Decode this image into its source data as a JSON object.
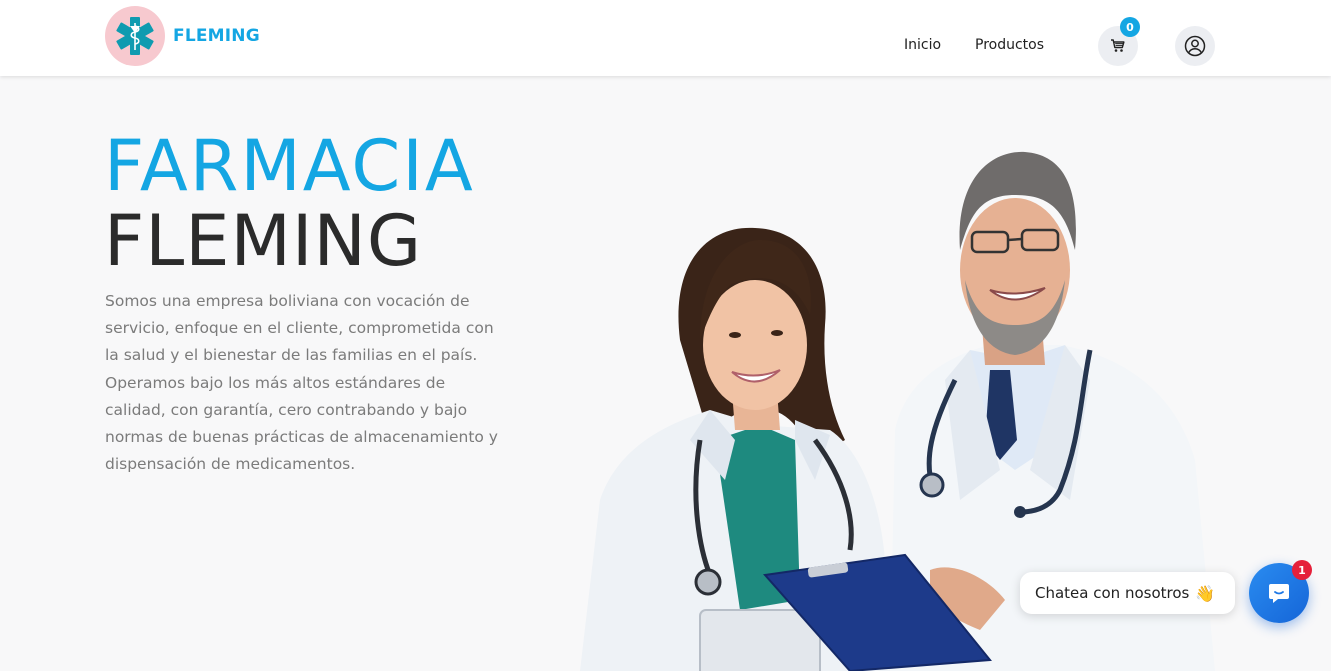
{
  "header": {
    "brand_name": "FLEMING",
    "logo_icon": "medical-star-of-life-icon",
    "nav": [
      {
        "label": "Inicio"
      },
      {
        "label": "Productos"
      }
    ],
    "cart_icon": "shopping-cart-icon",
    "cart_count": "0",
    "user_icon": "user-account-icon"
  },
  "hero": {
    "title_line1": "FARMACIA",
    "title_line2": "FLEMING",
    "description": "Somos una empresa boliviana con vocación de servicio, enfoque en el cliente, comprometida con la salud y el bienestar de las familias en el país. Operamos bajo los más altos estándares de calidad, con garantía, cero contrabando y bajo normas de buenas prácticas de almacenamiento y dispensación de medicamentos."
  },
  "chat": {
    "bubble_text": "Chatea con nosotros",
    "wave_emoji": "👋",
    "button_icon": "chat-message-icon",
    "unread_count": "1"
  },
  "colors": {
    "accent": "#14a6e3",
    "logo_bg": "#f7c9cf",
    "logo_fg": "#0f9bb0",
    "title_dark": "#2b2b2b",
    "text_muted": "#7b7b7b",
    "chat_blue": "#1e78e6",
    "badge_red": "#e5203a"
  }
}
